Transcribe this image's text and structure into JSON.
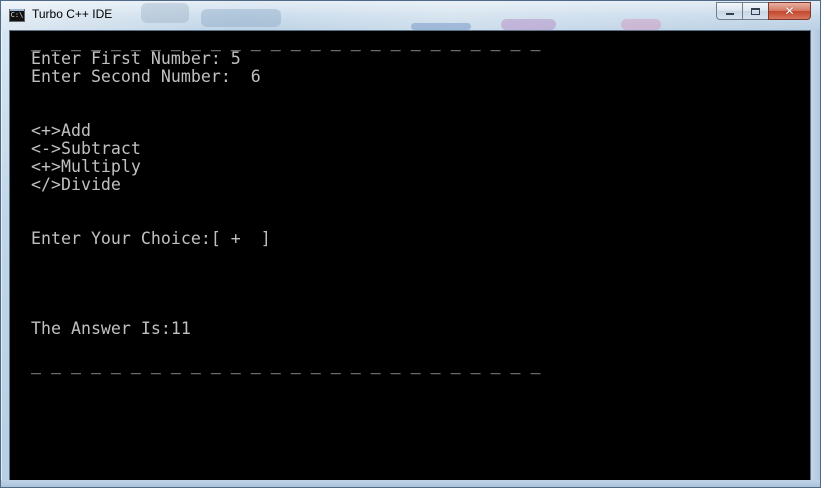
{
  "window": {
    "title": "Turbo C++ IDE",
    "icon": "console-app-icon",
    "icon_text": "C:\\"
  },
  "caption_buttons": {
    "minimize": "minimize-icon",
    "maximize": "maximize-icon",
    "close": "close-icon"
  },
  "console": {
    "top_rule": "_ _ _ _ _ _ _ _ _ _ _ _ _ _ _ _ _ _ _ _ _ _ _ _ _ _",
    "first_prompt": "Enter First Number: 5",
    "second_prompt": "Enter Second Number:  6",
    "menu": {
      "add": "<+>Add",
      "subtract": "<->Subtract",
      "multiply": "<+>Multiply",
      "divide": "</>Divide"
    },
    "choice_prompt": "Enter Your Choice:[ +  ]",
    "answer": "The Answer Is:11",
    "bottom_rule": "_ _ _ _ _ _ _ _ _ _ _ _ _ _ _ _ _ _ _ _ _ _ _ _ _ _"
  },
  "colors": {
    "console_background": "#000000",
    "console_text": "#c0c0c0",
    "close_button": "#c2472d"
  }
}
